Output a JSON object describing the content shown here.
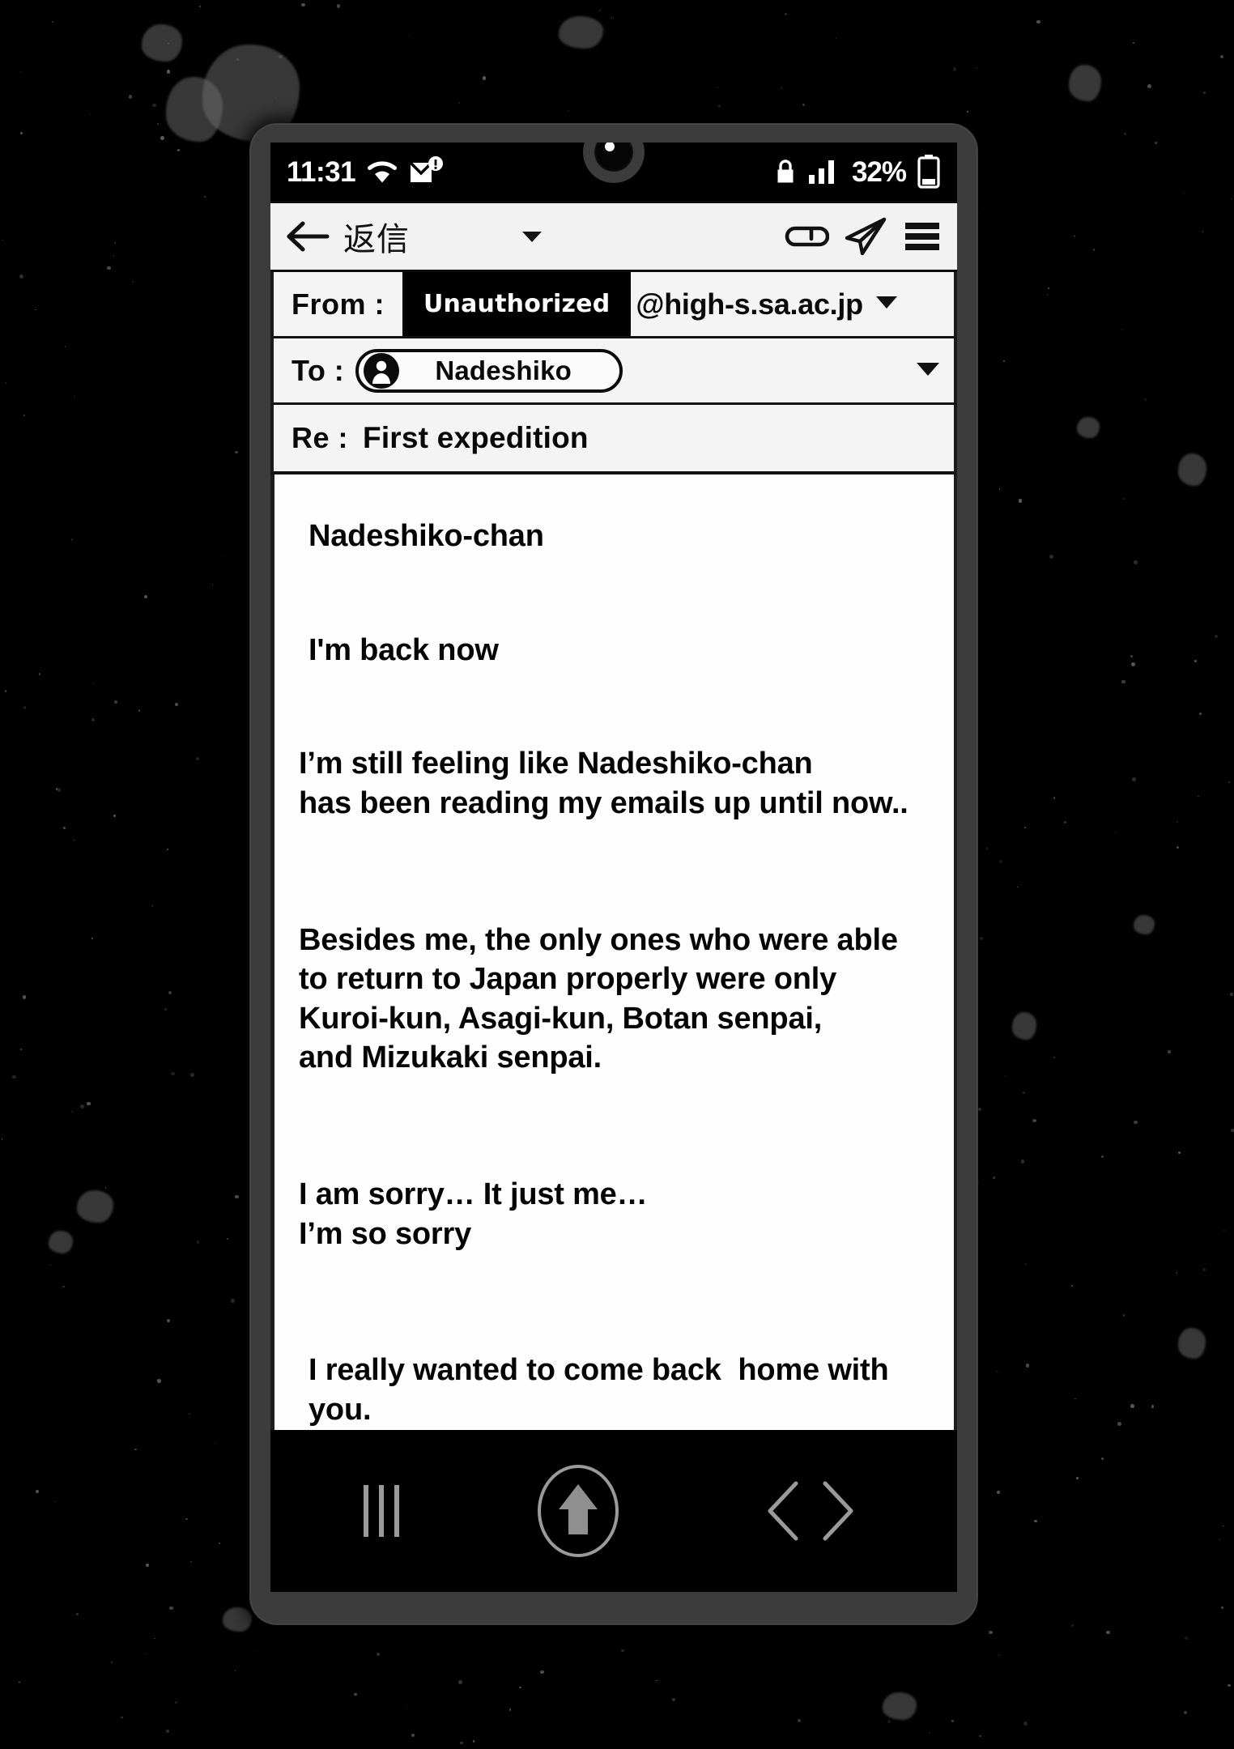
{
  "status_bar": {
    "time": "11:31",
    "wifi_icon": "wifi-icon",
    "mail_alert_icon": "mail-alert-icon",
    "lock_icon": "lock-icon",
    "signal_icon": "signal-bars-icon",
    "battery_percent": "32%",
    "battery_icon": "battery-icon"
  },
  "toolbar": {
    "back_icon": "back-arrow-icon",
    "title": "返信",
    "dropdown_icon": "chevron-down-icon",
    "attach_icon": "paperclip-icon",
    "send_icon": "send-paper-plane-icon",
    "menu_icon": "hamburger-menu-icon"
  },
  "compose": {
    "from": {
      "label": "From :",
      "redacted_value": "Unauthorized",
      "domain": "@high-s.sa.ac.jp",
      "dropdown_icon": "chevron-down-icon"
    },
    "to": {
      "label": "To :",
      "avatar_icon": "person-avatar-icon",
      "recipient": "Nadeshiko",
      "dropdown_icon": "chevron-down-icon"
    },
    "subject": {
      "label": "Re :",
      "value": "First expedition"
    },
    "body": {
      "greeting": "Nadeshiko-chan",
      "p1": "I'm back now",
      "p2": "I’m still feeling like Nadeshiko-chan\nhas been reading my emails up until now..",
      "p3": "Besides me, the only ones who were able\nto return to Japan properly were only\nKuroi-kun, Asagi-kun, Botan senpai,\nand Mizukaki senpai.",
      "p4": "I am sorry… It just me…\nI’m so sorry",
      "p5": "I really wanted to come back  home with you."
    }
  },
  "nav_bar": {
    "recents_icon": "recents-bars-icon",
    "home_icon": "home-up-arrow-icon",
    "back_forward_icon": "chevron-left-right-icon"
  },
  "colors": {
    "screen_chrome": "#f2f2f2",
    "ink": "#050505",
    "frame": "#3c3c3c",
    "backdrop": "#010101"
  }
}
